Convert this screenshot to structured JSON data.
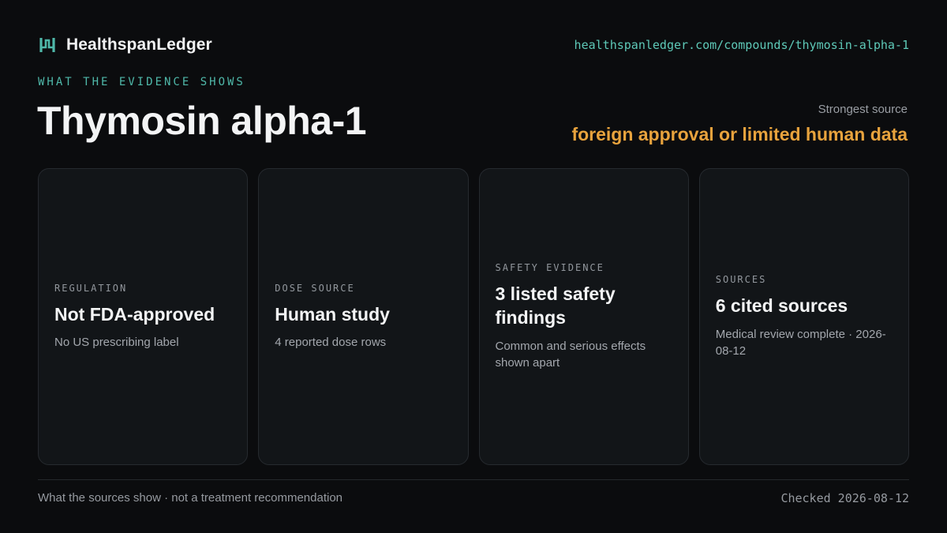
{
  "brand": {
    "name": "HealthspanLedger",
    "logo_icon": "ledger-bracket-icon",
    "accent_color": "#4fb8a9"
  },
  "header": {
    "url": "healthspanledger.com/compounds/thymosin-alpha-1"
  },
  "page": {
    "eyebrow": "WHAT THE EVIDENCE SHOWS",
    "title": "Thymosin alpha-1"
  },
  "strongest_source": {
    "label": "Strongest source",
    "value": "foreign approval or limited human data",
    "color": "#e8a33d"
  },
  "cards": [
    {
      "label": "REGULATION",
      "value": "Not FDA-approved",
      "note": "No US prescribing label"
    },
    {
      "label": "DOSE SOURCE",
      "value": "Human study",
      "note": "4 reported dose rows"
    },
    {
      "label": "SAFETY EVIDENCE",
      "value": "3 listed safety findings",
      "note": "Common and serious effects shown apart"
    },
    {
      "label": "SOURCES",
      "value": "6 cited sources",
      "note": "Medical review complete · 2026-08-12"
    }
  ],
  "footer": {
    "disclaimer": "What the sources show · not a treatment recommendation",
    "checked": "Checked 2026-08-12"
  }
}
